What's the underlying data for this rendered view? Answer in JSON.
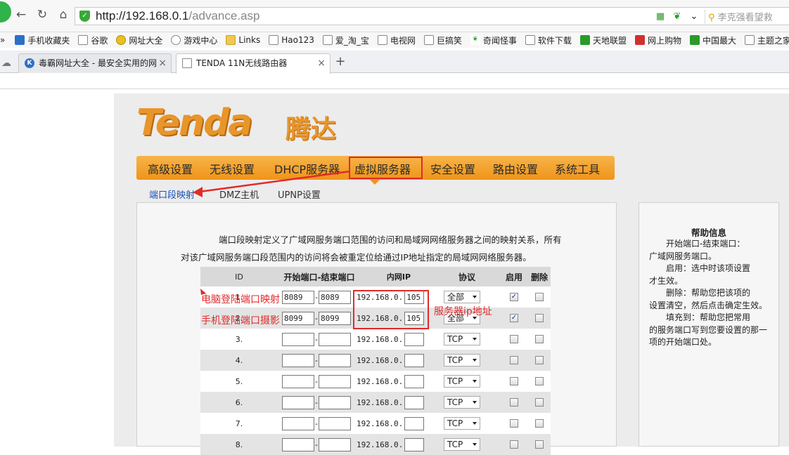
{
  "browser": {
    "url_host": "http://192.168.0.1",
    "url_path": "/advance.asp",
    "search_placeholder": "李克强看望救",
    "bookmarks": [
      "手机收藏夹",
      "谷歌",
      "网址大全",
      "游戏中心",
      "Links",
      "Hao123",
      "爱_淘_宝",
      "电视网",
      "巨搞笑",
      "奇闻怪事",
      "软件下载",
      "天地联盟",
      "网上购物",
      "中国最大",
      "主题之家"
    ],
    "tabs": [
      {
        "label": "毒霸网址大全 - 最安全实用的网",
        "icon": "k-logo-icon"
      },
      {
        "label": "TENDA 11N无线路由器",
        "icon": "page-icon"
      }
    ],
    "new_tab": "+"
  },
  "router": {
    "logo_text": "Tenda",
    "logo_cn": "腾达",
    "menu": [
      "高级设置",
      "无线设置",
      "DHCP服务器",
      "虚拟服务器",
      "安全设置",
      "路由设置",
      "系统工具"
    ],
    "active_menu": "虚拟服务器",
    "sub_nav": [
      "端口段映射",
      "DMZ主机",
      "UPNP设置"
    ],
    "intro_line1": "端口段映射定义了广域网服务端口范围的访问和局域网网络服务器之间的映射关系，所有",
    "intro_line2": "对该广域网服务端口段范围内的访问将会被重定位给通过IP地址指定的局域网网络服务器。",
    "table": {
      "headers": {
        "id": "ID",
        "ports": "开始端口-结束端口",
        "ip": "内网IP",
        "proto": "协议",
        "enable": "启用",
        "delete": "删除"
      },
      "ip_prefix": "192.168.0.",
      "rows": [
        {
          "id": "1.",
          "start": "8089",
          "end": "8089",
          "ip": "105",
          "proto": "全部",
          "enabled": true
        },
        {
          "id": "2.",
          "start": "8099",
          "end": "8099",
          "ip": "105",
          "proto": "全部",
          "enabled": true
        },
        {
          "id": "3.",
          "start": "",
          "end": "",
          "ip": "",
          "proto": "TCP",
          "enabled": false
        },
        {
          "id": "4.",
          "start": "",
          "end": "",
          "ip": "",
          "proto": "TCP",
          "enabled": false
        },
        {
          "id": "5.",
          "start": "",
          "end": "",
          "ip": "",
          "proto": "TCP",
          "enabled": false
        },
        {
          "id": "6.",
          "start": "",
          "end": "",
          "ip": "",
          "proto": "TCP",
          "enabled": false
        },
        {
          "id": "7.",
          "start": "",
          "end": "",
          "ip": "",
          "proto": "TCP",
          "enabled": false
        },
        {
          "id": "8.",
          "start": "",
          "end": "",
          "ip": "",
          "proto": "TCP",
          "enabled": false
        }
      ]
    },
    "help": {
      "title": "帮助信息",
      "items": [
        {
          "head": "开始端口-结束端口：",
          "body": "广域网服务端口。"
        },
        {
          "head": "启用：选中时该项设置",
          "body": "才生效。"
        },
        {
          "head": "删除：帮助您把该项的",
          "body": "设置清空，然后点击确定生效。"
        },
        {
          "head": "填充到：帮助您把常用",
          "body": "的服务端口写到您要设置的那一项的开始端口处。"
        }
      ]
    }
  },
  "annotations": {
    "row1": "电脑登陆端口映射",
    "row2": "手机登陆端口摄影",
    "server_ip": "服务器ip地址",
    "color": "#e02b2b"
  },
  "colors": {
    "menu_orange": "#ef9419",
    "logo_orange": "#e8952a",
    "link_blue": "#1a52b8"
  }
}
